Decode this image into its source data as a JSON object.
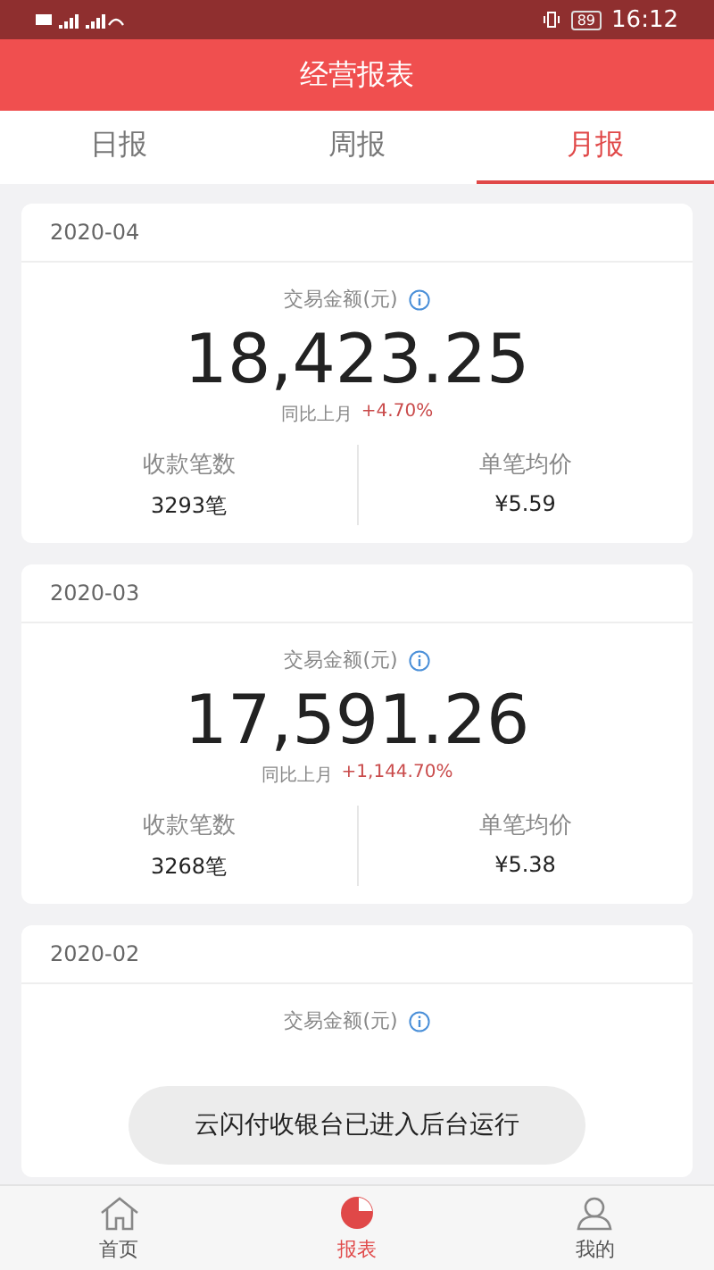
{
  "status_bar": {
    "battery": "89",
    "time": "16:12"
  },
  "header": {
    "title": "经营报表"
  },
  "tabs": [
    {
      "label": "日报",
      "selected": false
    },
    {
      "label": "周报",
      "selected": false
    },
    {
      "label": "月报",
      "selected": true
    }
  ],
  "reports": [
    {
      "date": "2020-04",
      "amount_label": "交易金额(元)",
      "amount": "18,423.25",
      "compare_label": "同比上月",
      "compare_value": "+4.70%",
      "stats": [
        {
          "label": "收款笔数",
          "value": "3293笔"
        },
        {
          "label": "单笔均价",
          "value": "¥5.59"
        }
      ]
    },
    {
      "date": "2020-03",
      "amount_label": "交易金额(元)",
      "amount": "17,591.26",
      "compare_label": "同比上月",
      "compare_value": "+1,144.70%",
      "stats": [
        {
          "label": "收款笔数",
          "value": "3268笔"
        },
        {
          "label": "单笔均价",
          "value": "¥5.38"
        }
      ]
    },
    {
      "date": "2020-02",
      "amount_label": "交易金额(元)"
    }
  ],
  "toast": "云闪付收银台已进入后台运行",
  "nav": [
    {
      "label": "首页",
      "kind": "home",
      "selected": false
    },
    {
      "label": "报表",
      "kind": "chart",
      "selected": true
    },
    {
      "label": "我的",
      "kind": "user",
      "selected": false
    }
  ]
}
